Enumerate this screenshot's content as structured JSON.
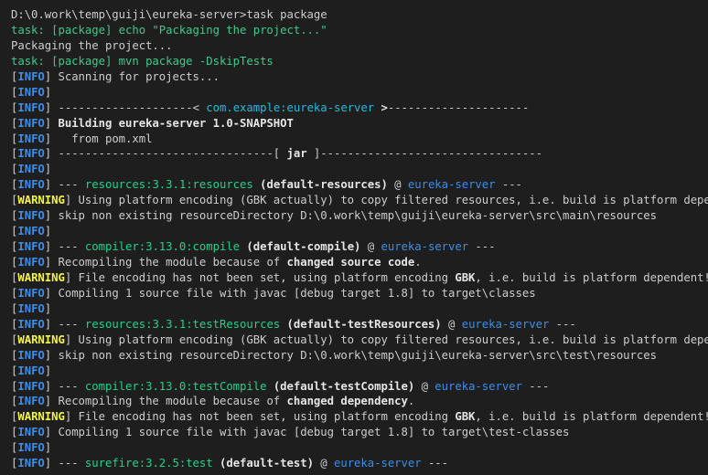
{
  "terminal": {
    "palette": {
      "background": "#1e1e1e",
      "default_text": "#cccccc",
      "bold_text": "#e5e5e5",
      "info_tag": "#3b8eea",
      "warning_tag": "#f5f543",
      "task_line": "#3ec98a",
      "artifact": "#29b8db",
      "plugin": "#23d18b",
      "project": "#3b8eea"
    },
    "lines": [
      {
        "segments": [
          {
            "text": "D:\\0.work\\temp\\guiji\\eureka-server>task package",
            "style": "default"
          }
        ]
      },
      {
        "segments": [
          {
            "text": "task: [package] echo \"Packaging the project...\"",
            "style": "green"
          }
        ]
      },
      {
        "segments": [
          {
            "text": "Packaging the project...",
            "style": "default"
          }
        ]
      },
      {
        "segments": [
          {
            "text": "task: [package] mvn package -DskipTests",
            "style": "green"
          }
        ]
      },
      {
        "segments": [
          {
            "text": "[",
            "style": "default"
          },
          {
            "text": "INFO",
            "style": "info"
          },
          {
            "text": "] Scanning for projects...",
            "style": "default"
          }
        ]
      },
      {
        "segments": [
          {
            "text": "[",
            "style": "default"
          },
          {
            "text": "INFO",
            "style": "info"
          },
          {
            "text": "]",
            "style": "default"
          }
        ]
      },
      {
        "segments": [
          {
            "text": "[",
            "style": "default"
          },
          {
            "text": "INFO",
            "style": "info"
          },
          {
            "text": "] ",
            "style": "default"
          },
          {
            "text": "--------------------< ",
            "style": "default"
          },
          {
            "text": "com.example:eureka-server",
            "style": "cyan"
          },
          {
            "text": " >",
            "style": "bold"
          },
          {
            "text": "---------------------",
            "style": "default"
          }
        ]
      },
      {
        "segments": [
          {
            "text": "[",
            "style": "default"
          },
          {
            "text": "INFO",
            "style": "info"
          },
          {
            "text": "] ",
            "style": "default"
          },
          {
            "text": "Building eureka-server 1.0-SNAPSHOT",
            "style": "bold"
          }
        ]
      },
      {
        "segments": [
          {
            "text": "[",
            "style": "default"
          },
          {
            "text": "INFO",
            "style": "info"
          },
          {
            "text": "]   from pom.xml",
            "style": "default"
          }
        ]
      },
      {
        "segments": [
          {
            "text": "[",
            "style": "default"
          },
          {
            "text": "INFO",
            "style": "info"
          },
          {
            "text": "] ",
            "style": "default"
          },
          {
            "text": "--------------------------------[ ",
            "style": "default"
          },
          {
            "text": "jar",
            "style": "bold"
          },
          {
            "text": " ]---------------------------------",
            "style": "default"
          }
        ]
      },
      {
        "segments": [
          {
            "text": "[",
            "style": "default"
          },
          {
            "text": "INFO",
            "style": "info"
          },
          {
            "text": "]",
            "style": "default"
          }
        ]
      },
      {
        "segments": [
          {
            "text": "[",
            "style": "default"
          },
          {
            "text": "INFO",
            "style": "info"
          },
          {
            "text": "] --- ",
            "style": "default"
          },
          {
            "text": "resources:3.3.1:resources",
            "style": "module"
          },
          {
            "text": " ",
            "style": "default"
          },
          {
            "text": "(default-resources)",
            "style": "bold"
          },
          {
            "text": " @ ",
            "style": "default"
          },
          {
            "text": "eureka-server",
            "style": "project"
          },
          {
            "text": " ---",
            "style": "default"
          }
        ]
      },
      {
        "segments": [
          {
            "text": "[",
            "style": "default"
          },
          {
            "text": "WARNING",
            "style": "warning"
          },
          {
            "text": "] Using platform encoding (GBK actually) to copy filtered resources, i.e. build is platform dependent!",
            "style": "default"
          }
        ]
      },
      {
        "segments": [
          {
            "text": "[",
            "style": "default"
          },
          {
            "text": "INFO",
            "style": "info"
          },
          {
            "text": "] skip non existing resourceDirectory D:\\0.work\\temp\\guiji\\eureka-server\\src\\main\\resources",
            "style": "default"
          }
        ]
      },
      {
        "segments": [
          {
            "text": "[",
            "style": "default"
          },
          {
            "text": "INFO",
            "style": "info"
          },
          {
            "text": "]",
            "style": "default"
          }
        ]
      },
      {
        "segments": [
          {
            "text": "[",
            "style": "default"
          },
          {
            "text": "INFO",
            "style": "info"
          },
          {
            "text": "] --- ",
            "style": "default"
          },
          {
            "text": "compiler:3.13.0:compile",
            "style": "module"
          },
          {
            "text": " ",
            "style": "default"
          },
          {
            "text": "(default-compile)",
            "style": "bold"
          },
          {
            "text": " @ ",
            "style": "default"
          },
          {
            "text": "eureka-server",
            "style": "project"
          },
          {
            "text": " ---",
            "style": "default"
          }
        ]
      },
      {
        "segments": [
          {
            "text": "[",
            "style": "default"
          },
          {
            "text": "INFO",
            "style": "info"
          },
          {
            "text": "] Recompiling the module because of ",
            "style": "default"
          },
          {
            "text": "changed source code",
            "style": "bold"
          },
          {
            "text": ".",
            "style": "default"
          }
        ]
      },
      {
        "segments": [
          {
            "text": "[",
            "style": "default"
          },
          {
            "text": "WARNING",
            "style": "warning"
          },
          {
            "text": "] File encoding has not been set, using platform encoding ",
            "style": "default"
          },
          {
            "text": "GBK",
            "style": "bold"
          },
          {
            "text": ", i.e. build is platform dependent!",
            "style": "default"
          }
        ]
      },
      {
        "segments": [
          {
            "text": "[",
            "style": "default"
          },
          {
            "text": "INFO",
            "style": "info"
          },
          {
            "text": "] Compiling 1 source file with javac [debug target 1.8] to target\\classes",
            "style": "default"
          }
        ]
      },
      {
        "segments": [
          {
            "text": "[",
            "style": "default"
          },
          {
            "text": "INFO",
            "style": "info"
          },
          {
            "text": "]",
            "style": "default"
          }
        ]
      },
      {
        "segments": [
          {
            "text": "[",
            "style": "default"
          },
          {
            "text": "INFO",
            "style": "info"
          },
          {
            "text": "] --- ",
            "style": "default"
          },
          {
            "text": "resources:3.3.1:testResources",
            "style": "module"
          },
          {
            "text": " ",
            "style": "default"
          },
          {
            "text": "(default-testResources)",
            "style": "bold"
          },
          {
            "text": " @ ",
            "style": "default"
          },
          {
            "text": "eureka-server",
            "style": "project"
          },
          {
            "text": " ---",
            "style": "default"
          }
        ]
      },
      {
        "segments": [
          {
            "text": "[",
            "style": "default"
          },
          {
            "text": "WARNING",
            "style": "warning"
          },
          {
            "text": "] Using platform encoding (GBK actually) to copy filtered resources, i.e. build is platform dependent!",
            "style": "default"
          }
        ]
      },
      {
        "segments": [
          {
            "text": "[",
            "style": "default"
          },
          {
            "text": "INFO",
            "style": "info"
          },
          {
            "text": "] skip non existing resourceDirectory D:\\0.work\\temp\\guiji\\eureka-server\\src\\test\\resources",
            "style": "default"
          }
        ]
      },
      {
        "segments": [
          {
            "text": "[",
            "style": "default"
          },
          {
            "text": "INFO",
            "style": "info"
          },
          {
            "text": "]",
            "style": "default"
          }
        ]
      },
      {
        "segments": [
          {
            "text": "[",
            "style": "default"
          },
          {
            "text": "INFO",
            "style": "info"
          },
          {
            "text": "] --- ",
            "style": "default"
          },
          {
            "text": "compiler:3.13.0:testCompile",
            "style": "module"
          },
          {
            "text": " ",
            "style": "default"
          },
          {
            "text": "(default-testCompile)",
            "style": "bold"
          },
          {
            "text": " @ ",
            "style": "default"
          },
          {
            "text": "eureka-server",
            "style": "project"
          },
          {
            "text": " ---",
            "style": "default"
          }
        ]
      },
      {
        "segments": [
          {
            "text": "[",
            "style": "default"
          },
          {
            "text": "INFO",
            "style": "info"
          },
          {
            "text": "] Recompiling the module because of ",
            "style": "default"
          },
          {
            "text": "changed dependency",
            "style": "bold"
          },
          {
            "text": ".",
            "style": "default"
          }
        ]
      },
      {
        "segments": [
          {
            "text": "[",
            "style": "default"
          },
          {
            "text": "WARNING",
            "style": "warning"
          },
          {
            "text": "] File encoding has not been set, using platform encoding ",
            "style": "default"
          },
          {
            "text": "GBK",
            "style": "bold"
          },
          {
            "text": ", i.e. build is platform dependent!",
            "style": "default"
          }
        ]
      },
      {
        "segments": [
          {
            "text": "[",
            "style": "default"
          },
          {
            "text": "INFO",
            "style": "info"
          },
          {
            "text": "] Compiling 1 source file with javac [debug target 1.8] to target\\test-classes",
            "style": "default"
          }
        ]
      },
      {
        "segments": [
          {
            "text": "[",
            "style": "default"
          },
          {
            "text": "INFO",
            "style": "info"
          },
          {
            "text": "]",
            "style": "default"
          }
        ]
      },
      {
        "segments": [
          {
            "text": "[",
            "style": "default"
          },
          {
            "text": "INFO",
            "style": "info"
          },
          {
            "text": "] --- ",
            "style": "default"
          },
          {
            "text": "surefire:3.2.5:test",
            "style": "module"
          },
          {
            "text": " ",
            "style": "default"
          },
          {
            "text": "(default-test)",
            "style": "bold"
          },
          {
            "text": " @ ",
            "style": "default"
          },
          {
            "text": "eureka-server",
            "style": "project"
          },
          {
            "text": " ---",
            "style": "default"
          }
        ]
      }
    ]
  }
}
